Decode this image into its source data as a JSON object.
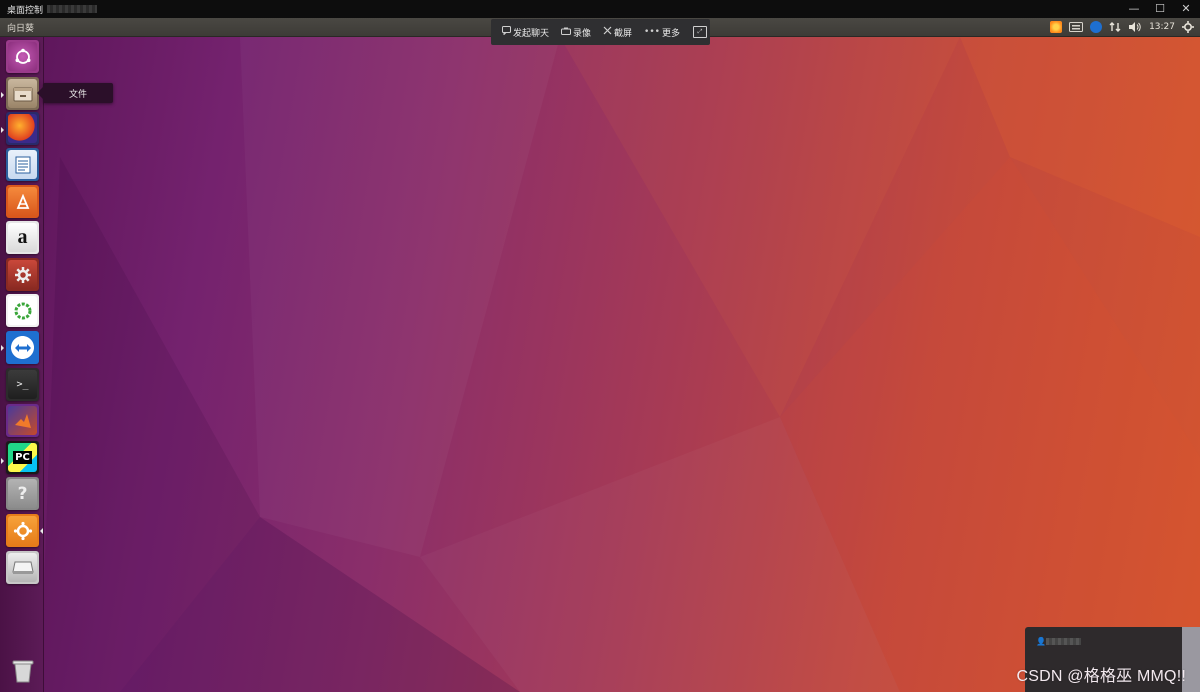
{
  "outer_window": {
    "title": "桌面控制",
    "controls": [
      "—",
      "☐",
      "✕"
    ]
  },
  "panel": {
    "app_name": "向日葵",
    "time": "13:27"
  },
  "toolbar": {
    "chat_label": "发起聊天",
    "record_label": "录像",
    "screenshot_label": "截屏",
    "more_label": "更多"
  },
  "launcher": {
    "tooltip": "文件",
    "items": [
      {
        "name": "ubuntu-dash-icon",
        "label": "Dash"
      },
      {
        "name": "files-icon",
        "label": "文件"
      },
      {
        "name": "firefox-icon",
        "label": "Firefox"
      },
      {
        "name": "libreoffice-writer-icon",
        "label": "Writer"
      },
      {
        "name": "ubuntu-software-icon",
        "label": "Software"
      },
      {
        "name": "amazon-icon",
        "label": "Amazon"
      },
      {
        "name": "system-settings-icon",
        "label": "Settings"
      },
      {
        "name": "update-icon",
        "label": "Update"
      },
      {
        "name": "teamviewer-icon",
        "label": "TeamViewer"
      },
      {
        "name": "terminal-icon",
        "label": "Terminal"
      },
      {
        "name": "matlab-icon",
        "label": "MATLAB"
      },
      {
        "name": "pycharm-icon",
        "label": "PyCharm"
      },
      {
        "name": "help-icon",
        "label": "Help"
      },
      {
        "name": "sunlogin-icon",
        "label": "Sunlogin"
      },
      {
        "name": "drive-icon",
        "label": "Drive"
      },
      {
        "name": "trash-icon",
        "label": "Trash"
      }
    ],
    "pycharm_text": "PC",
    "terminal_text": ">_",
    "help_text": "?",
    "amazon_text": "a"
  },
  "watermark": "CSDN @格格巫 MMQ!!",
  "colors": {
    "launcher_bg": "#5c1b57",
    "wallpaper_left": "#5a1458",
    "wallpaper_right": "#d4552f"
  }
}
